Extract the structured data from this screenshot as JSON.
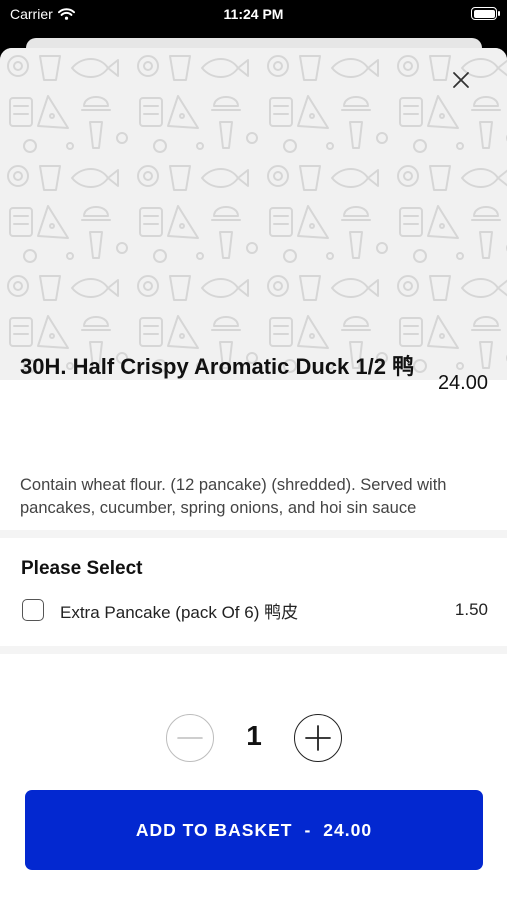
{
  "status_bar": {
    "carrier": "Carrier",
    "time": "11:24 PM"
  },
  "item": {
    "title": "30H. Half Crispy Aromatic Duck 1/2 鸭",
    "price": "24.00",
    "description": "Contain wheat flour. (12 pancake) (shredded). Served with pancakes, cucumber, spring onions, and hoi sin sauce"
  },
  "options_section": {
    "title": "Please Select",
    "options": [
      {
        "label": "Extra Pancake (pack Of 6) 鸭皮",
        "price": "1.50",
        "checked": false
      }
    ]
  },
  "quantity": {
    "value": "1"
  },
  "add_button": {
    "label": "ADD TO BASKET",
    "separator": "-",
    "price": "24.00",
    "color": "#0328d0"
  },
  "icons": {
    "close": "close-icon",
    "minus": "minus-icon",
    "plus": "plus-icon",
    "wifi": "wifi-icon",
    "battery": "battery-icon"
  }
}
